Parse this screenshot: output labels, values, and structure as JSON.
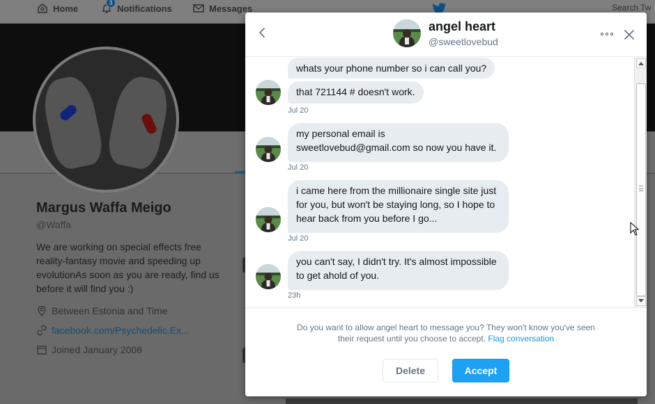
{
  "nav": {
    "home": "Home",
    "notifications": "Notifications",
    "notifications_badge": "3",
    "messages": "Messages",
    "search_placeholder": "Search Tw"
  },
  "profile": {
    "name": "Margus Waffa Meigo",
    "handle": "@Waffa",
    "bio": "We are working on special effects free reality-fantasy movie and speeding up evolutionAs soon as you are ready, find us before it will find you :)",
    "location": "Between Estonia and Time",
    "link": "facebook.com/Psychedelic.Ex...",
    "joined": "Joined January 2008"
  },
  "modal": {
    "name": "angel heart",
    "handle": "@sweetlovebud",
    "messages": [
      {
        "text": "whats your phone number so i can call you?"
      },
      {
        "text": "that 721144 # doesn't work.",
        "time": "Jul 20"
      },
      {
        "text": "my personal email is sweetlovebud@gmail.com so now you have it.",
        "time": "Jul 20"
      },
      {
        "text": "i came here from the millionaire single site just for you, but won't be staying long, so I hope to hear back from you before I go...",
        "time": "Jul 20"
      },
      {
        "text": "you can't say, I didn't try.  It's almost impossible to get ahold of you.",
        "time": "23h"
      }
    ],
    "request_text": "Do you want to allow angel heart to message you? They won't know you've seen their request until you choose to accept.",
    "flag_link": "Flag conversation",
    "delete_label": "Delete",
    "accept_label": "Accept"
  },
  "colors": {
    "accent": "#1da1f2",
    "bubble": "#e6ecf0",
    "muted_text": "#657786"
  }
}
